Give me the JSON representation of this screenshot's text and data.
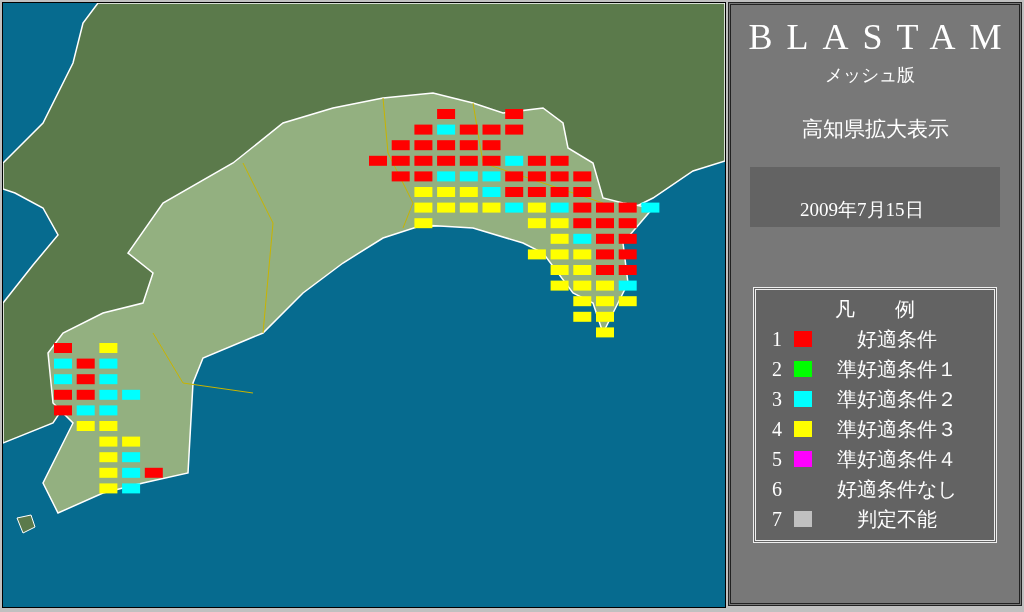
{
  "app": {
    "title": "BLASTAM",
    "subtitle": "メッシュ版"
  },
  "view_label": "高知県拡大表示",
  "date": "2009年7月15日",
  "legend": {
    "title": "凡　　例",
    "items": [
      {
        "number": "1",
        "label": "好適条件",
        "kind": "swatch",
        "color": "#ff0000"
      },
      {
        "number": "2",
        "label": "準好適条件１",
        "kind": "swatch",
        "color": "#00ff00"
      },
      {
        "number": "3",
        "label": "準好適条件２",
        "kind": "swatch",
        "color": "#00ffff"
      },
      {
        "number": "4",
        "label": "準好適条件３",
        "kind": "swatch",
        "color": "#ffff00"
      },
      {
        "number": "5",
        "label": "準好適条件４",
        "kind": "swatch",
        "color": "#ff00ff"
      },
      {
        "number": "6",
        "label": "好適条件なし",
        "kind": "none"
      },
      {
        "number": "7",
        "label": "判定不能",
        "kind": "swatch",
        "color": "#c0c0c0"
      }
    ]
  }
}
